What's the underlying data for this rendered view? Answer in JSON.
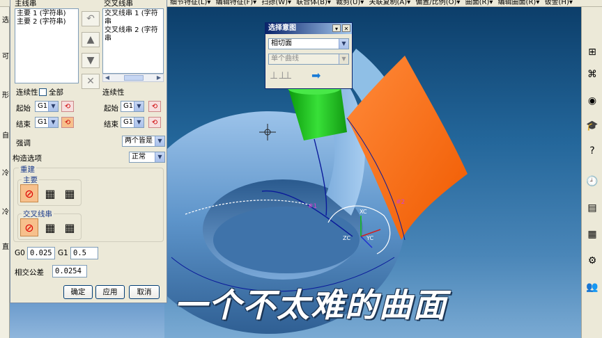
{
  "menubar": {
    "items": [
      "细节特征(L)▾",
      "编辑特征(F)▾",
      "扫掠(W)▾",
      "联合体(B)▾",
      "裁剪(U)▾",
      "关联复制(A)▾",
      "偏置/比例(O)▾",
      "曲面(R)▾",
      "编辑曲面(R)▾",
      "钣金(H)▾"
    ]
  },
  "left_strip": {
    "labels": [
      "选",
      "可",
      "形",
      "自",
      "冷",
      "冷",
      "直"
    ]
  },
  "dialog": {
    "primary_header": "主线串",
    "cross_header": "交叉线串",
    "primary_items": [
      "主要 1 (字符串)",
      "主要 2 (字符串)"
    ],
    "cross_items": [
      "交叉线串 1 (字符串",
      "交叉线串 2 (字符串"
    ],
    "continuity_label": "连续性",
    "all_label": "全部",
    "start_label": "起始",
    "end_label": "结束",
    "g1": "G1",
    "cross_continuity_label": "连续性",
    "emphasis_label": "强调",
    "emphasis_value": "两个皆是",
    "build_options_label": "构造选项",
    "build_options_value": "正常",
    "rebuild_label": "重建",
    "rebuild_primary": "主要",
    "rebuild_cross": "交叉线串",
    "g0_label": "G0",
    "g0_value": "0.025",
    "g1_label": "G1",
    "g1_value": "0.5",
    "intersect_tol_label": "相交公差",
    "intersect_tol_value": "0.0254",
    "ok": "确定",
    "apply": "应用",
    "cancel": "取消"
  },
  "intent": {
    "title": "选择意图",
    "option1": "相切面",
    "option2": "单个曲线"
  },
  "viewport": {
    "labels": {
      "xc": "XC",
      "zc": "ZC",
      "yc": "YC",
      "n1": "#1",
      "n2": "#2"
    }
  },
  "caption": "一个不太难的曲面",
  "colors": {
    "accent_orange": "#ff6a10",
    "green_surface": "#20c020",
    "background_blue": "#1e5a8a"
  }
}
